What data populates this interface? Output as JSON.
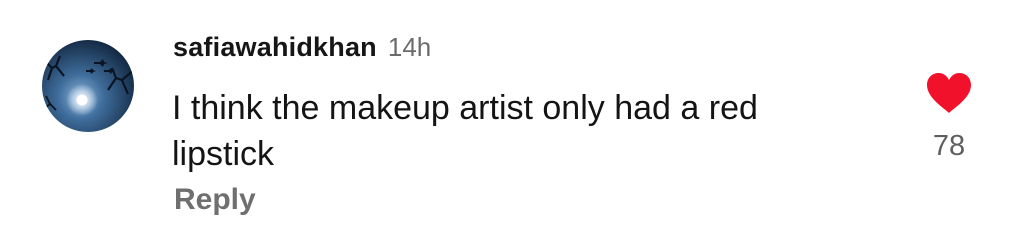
{
  "comment": {
    "username": "safiawahidkhan",
    "timestamp": "14h",
    "text_line1": "I think the makeup artist only had a red",
    "text_line2": "lipstick",
    "reply_label": "Reply",
    "like_count": "78",
    "liked": true
  },
  "icons": {
    "avatar": "night-moon-avatar-icon",
    "like": "heart-icon"
  },
  "colors": {
    "heart": "#f1112b",
    "username": "#161616",
    "muted": "#6f6f6f"
  }
}
